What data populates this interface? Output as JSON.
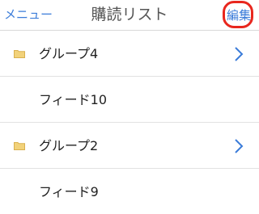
{
  "navbar": {
    "menu_label": "メニュー",
    "title": "購読リスト",
    "edit_label": "編集"
  },
  "rows": [
    {
      "label": "グループ4",
      "icon": "folder-icon",
      "disclosure": "chevron-right-icon"
    },
    {
      "label": "フィード10"
    },
    {
      "label": "グループ2",
      "icon": "folder-icon",
      "disclosure": "chevron-right-icon"
    },
    {
      "label": "フィード9"
    }
  ],
  "colors": {
    "accent": "#3b7cd9",
    "highlight_ring": "#e8271e",
    "folder": "#f2d27a"
  }
}
